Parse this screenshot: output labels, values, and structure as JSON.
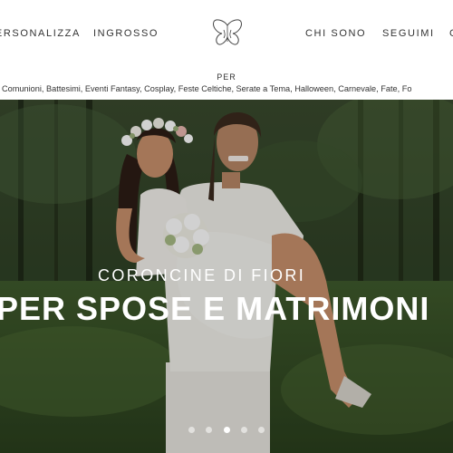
{
  "nav": {
    "left_items": [
      "PERSONALIZZA",
      "INGROSSO"
    ],
    "right_items": [
      "CHI SONO",
      "SEGUIMI"
    ]
  },
  "per_label": "PER",
  "categories": "Comunioni, Battesimi, Eventi Fantasy, Cosplay, Feste Celtiche, Serate a Tema, Halloween, Carnevale, Fate, Fo",
  "hero": {
    "subtitle": "CORONCINE DI FIORI",
    "title": "PER SPOSE E MATRIMONI",
    "slides": 5,
    "active_slide": 3
  },
  "colors": {
    "nav_text": "#333333",
    "hero_text": "#ffffff"
  }
}
